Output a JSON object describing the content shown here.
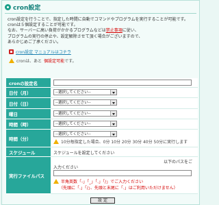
{
  "title": "cron設定",
  "intro": [
    "cron設定を行うことで、指定した時間に自動でコマンドやプログラムを実行することが可能です。",
    "cronは５個設定することが可能です。",
    "なお、サーバーに高い負荷がかかるプログラムなどは",
    "プログラムの実行の停止や、設定解除させて頂く場合がございますので、",
    "あらかじめご了承ください。"
  ],
  "intro_link": "禁止事項",
  "intro_link_after": "に従い、",
  "manual_link": "cron設定 マニュアルはコチラ",
  "status_prefix": "cronは、あと",
  "status_value": "個設定可能",
  "status_suffix": "です。",
  "form": {
    "name_label": "cronの設定名",
    "month_label": "日付（月）",
    "day_label": "日付（日）",
    "weekday_label": "曜日",
    "hour_label": "時間（時）",
    "minute_label": "時間（分）",
    "select_placeholder": "--選択してください--",
    "minute_hint": "10分毎指定した場合、0分 10分 20分 30分 40分 50分に実行します",
    "schedule_label": "スケジュール",
    "schedule_value": "スケジュールを設定してください",
    "path_label": "実行ファイルパス",
    "path_hint_right": "以下のパスをご",
    "path_hint_left": "入力ください",
    "path_warn1": "半角英数「-」「_」「.」「/」でご入力ください",
    "path_warn2": "（先頭に「.」「/」、先頭と末尾に「.」はご利用いただけません）",
    "submit_label": "設 定"
  }
}
